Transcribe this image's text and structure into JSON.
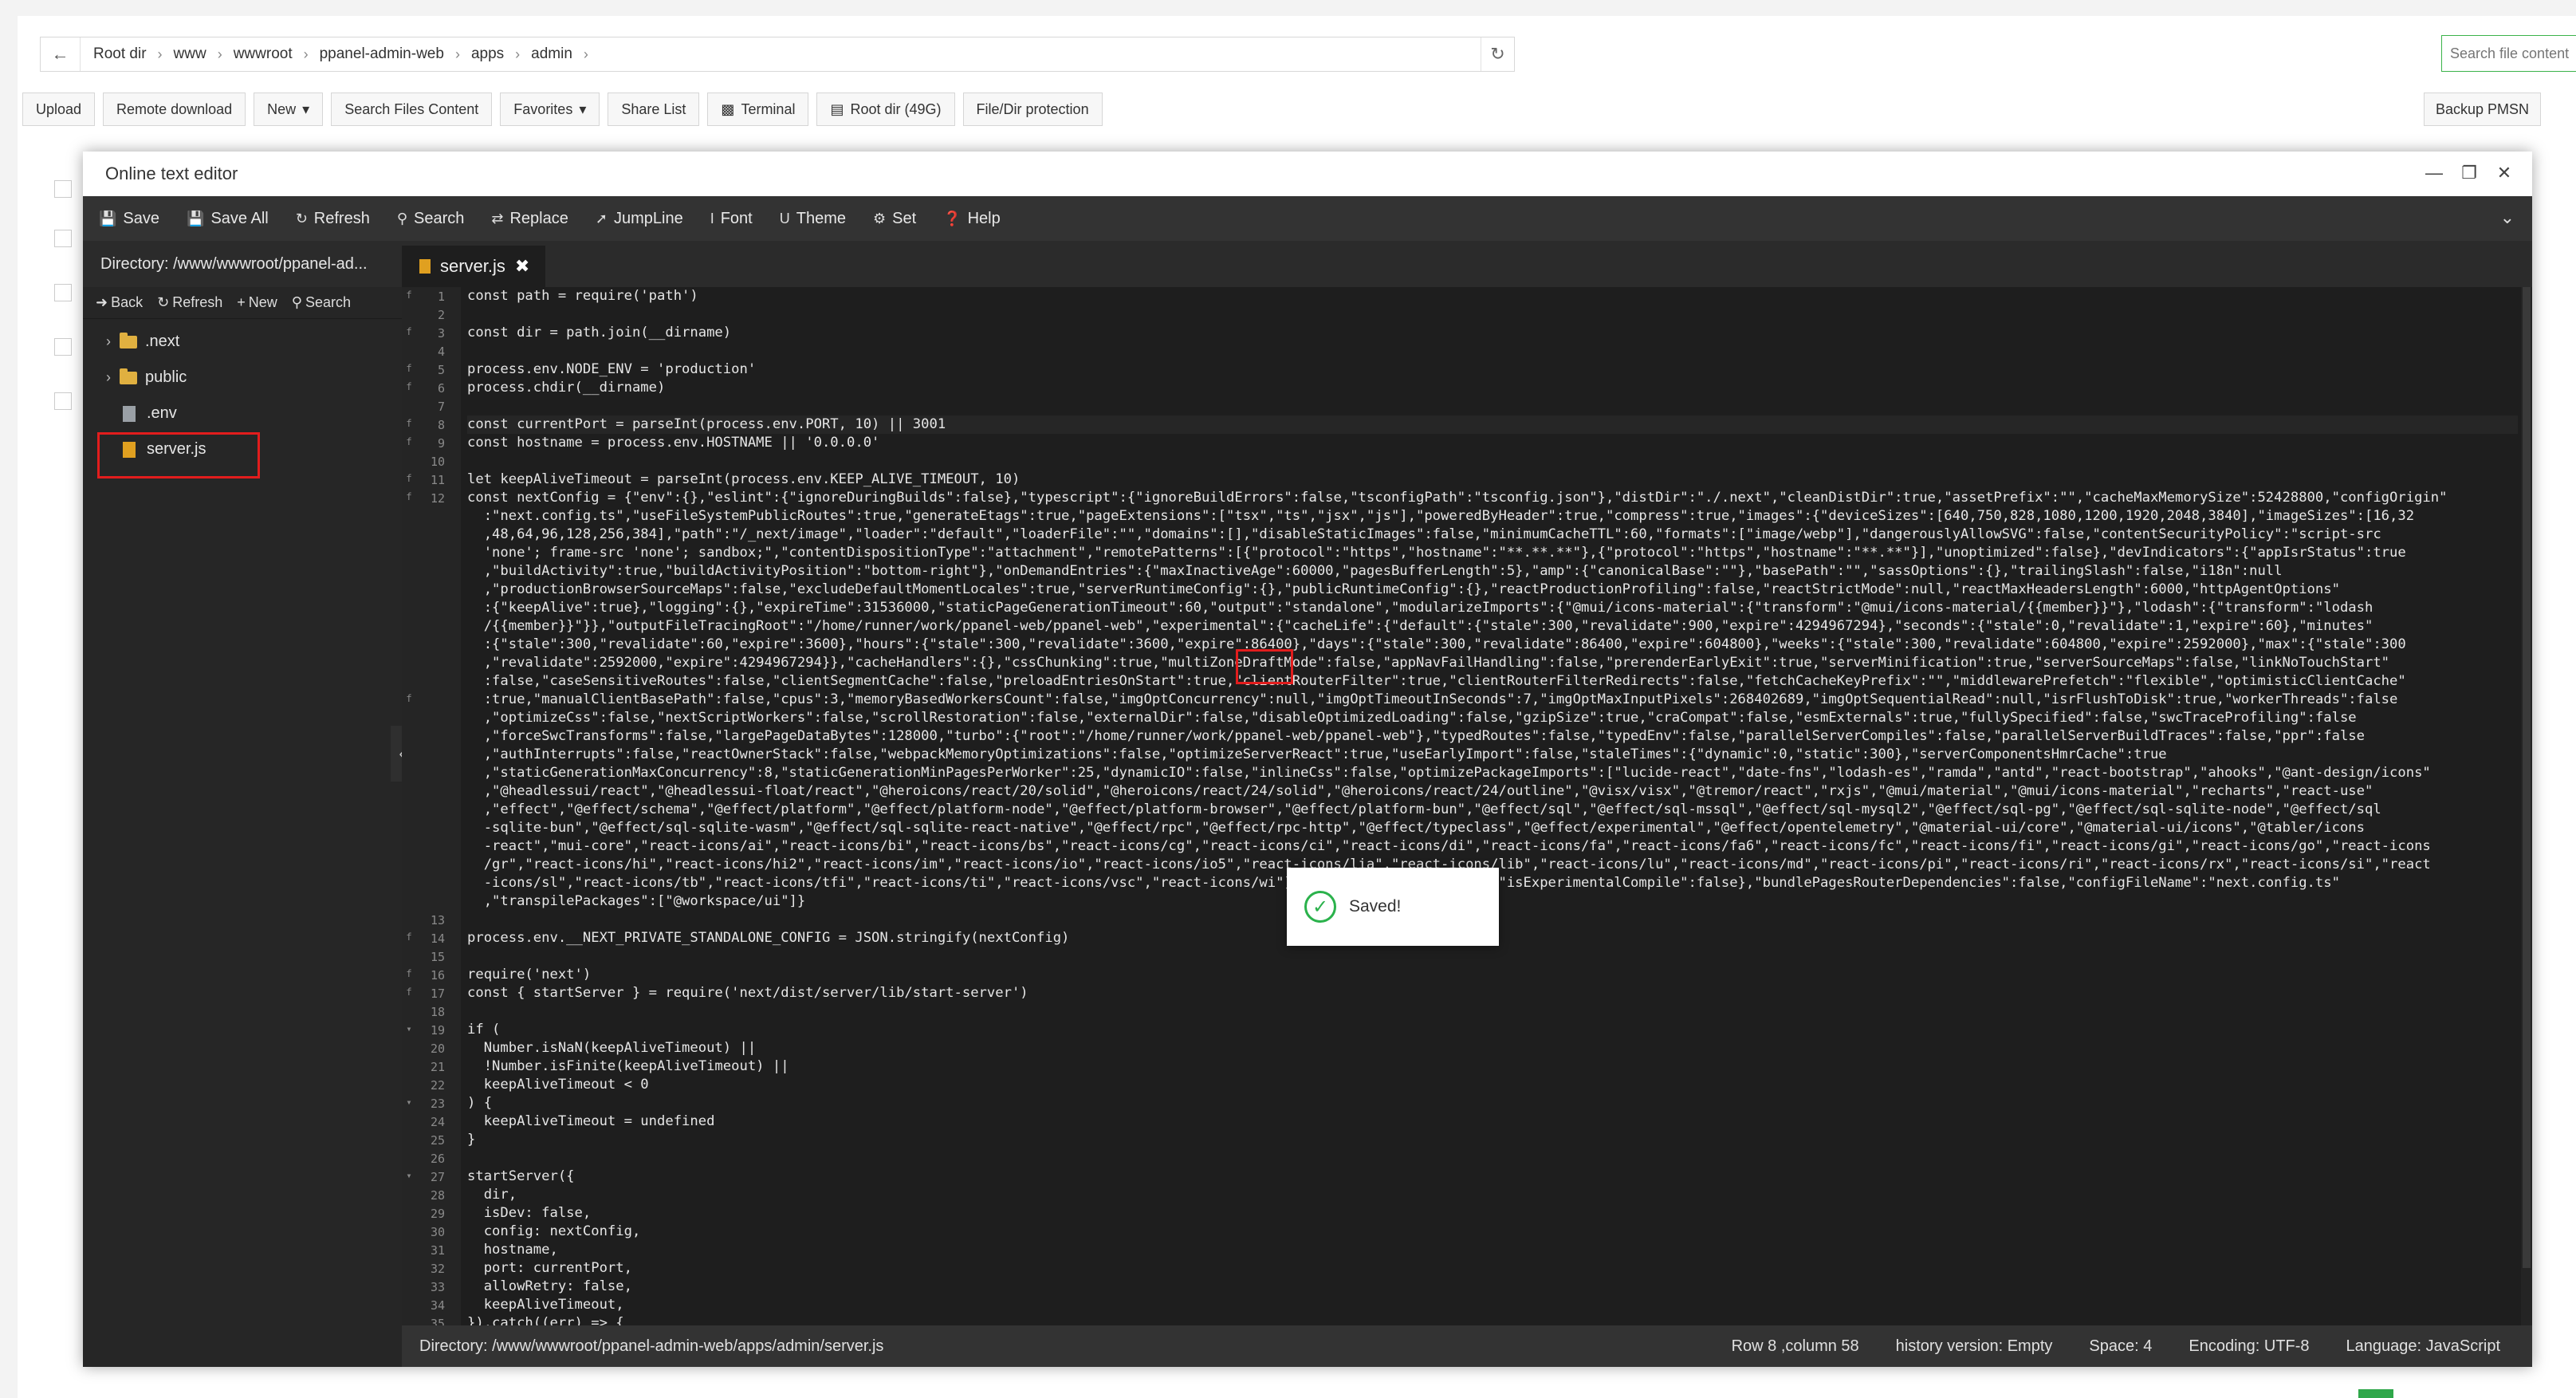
{
  "file_manager": {
    "breadcrumbs": [
      "Root dir",
      "www",
      "wwwroot",
      "ppanel-admin-web",
      "apps",
      "admin"
    ],
    "search_placeholder": "Search file content",
    "toolbar": {
      "upload": "Upload",
      "remote_download": "Remote download",
      "new": "New",
      "search_files_content": "Search Files Content",
      "favorites": "Favorites",
      "share_list": "Share List",
      "terminal": "Terminal",
      "root_dir": "Root dir (49G)",
      "file_dir_protection": "File/Dir protection",
      "backup": "Backup PMSN"
    }
  },
  "editor": {
    "window_title": "Online text editor",
    "toolbar": {
      "save": "Save",
      "save_all": "Save All",
      "refresh": "Refresh",
      "search": "Search",
      "replace": "Replace",
      "jumpline": "JumpLine",
      "font": "Font",
      "theme": "Theme",
      "set": "Set",
      "help": "Help"
    },
    "sidebar": {
      "directory": "Directory: /www/wwwroot/ppanel-ad...",
      "actions": {
        "back": "Back",
        "refresh": "Refresh",
        "new": "New",
        "search": "Search"
      },
      "tree": [
        {
          "name": ".next",
          "type": "folder"
        },
        {
          "name": "public",
          "type": "folder"
        },
        {
          "name": ".env",
          "type": "file"
        },
        {
          "name": "server.js",
          "type": "file"
        }
      ]
    },
    "tab": {
      "name": "server.js"
    },
    "toast": "Saved!",
    "status": {
      "directory": "Directory: /www/wwwroot/ppanel-admin-web/apps/admin/server.js",
      "position": "Row 8 ,column 58",
      "history": "history version: Empty",
      "space": "Space: 4",
      "encoding": "Encoding: UTF-8",
      "language": "Language: JavaScript"
    },
    "code": {
      "l1": "const path = require('path')",
      "l3": "const dir = path.join(__dirname)",
      "l5": "process.env.NODE_ENV = 'production'",
      "l6": "process.chdir(__dirname)",
      "l8": "const currentPort = parseInt(process.env.PORT, 10) || 3001",
      "l9": "const hostname = process.env.HOSTNAME || '0.0.0.0'",
      "l11": "let keepAliveTimeout = parseInt(process.env.KEEP_ALIVE_TIMEOUT, 10)",
      "l12": [
        "const nextConfig = {\"env\":{},\"eslint\":{\"ignoreDuringBuilds\":false},\"typescript\":{\"ignoreBuildErrors\":false,\"tsconfigPath\":\"tsconfig.json\"},\"distDir\":\"./.next\",\"cleanDistDir\":true,\"assetPrefix\":\"\",\"cacheMaxMemorySize\":52428800,\"configOrigin\"",
        "  :\"next.config.ts\",\"useFileSystemPublicRoutes\":true,\"generateEtags\":true,\"pageExtensions\":[\"tsx\",\"ts\",\"jsx\",\"js\"],\"poweredByHeader\":true,\"compress\":true,\"images\":{\"deviceSizes\":[640,750,828,1080,1200,1920,2048,3840],\"imageSizes\":[16,32",
        "  ,48,64,96,128,256,384],\"path\":\"/_next/image\",\"loader\":\"default\",\"loaderFile\":\"\",\"domains\":[],\"disableStaticImages\":false,\"minimumCacheTTL\":60,\"formats\":[\"image/webp\"],\"dangerouslyAllowSVG\":false,\"contentSecurityPolicy\":\"script-src",
        "  'none'; frame-src 'none'; sandbox;\",\"contentDispositionType\":\"attachment\",\"remotePatterns\":[{\"protocol\":\"https\",\"hostname\":\"**.**.**\"},{\"protocol\":\"https\",\"hostname\":\"**.**\"}],\"unoptimized\":false},\"devIndicators\":{\"appIsrStatus\":true",
        "  ,\"buildActivity\":true,\"buildActivityPosition\":\"bottom-right\"},\"onDemandEntries\":{\"maxInactiveAge\":60000,\"pagesBufferLength\":5},\"amp\":{\"canonicalBase\":\"\"},\"basePath\":\"\",\"sassOptions\":{},\"trailingSlash\":false,\"i18n\":null",
        "  ,\"productionBrowserSourceMaps\":false,\"excludeDefaultMomentLocales\":true,\"serverRuntimeConfig\":{},\"publicRuntimeConfig\":{},\"reactProductionProfiling\":false,\"reactStrictMode\":null,\"reactMaxHeadersLength\":6000,\"httpAgentOptions\"",
        "  :{\"keepAlive\":true},\"logging\":{},\"expireTime\":31536000,\"staticPageGenerationTimeout\":60,\"output\":\"standalone\",\"modularizeImports\":{\"@mui/icons-material\":{\"transform\":\"@mui/icons-material/{{member}}\"},\"lodash\":{\"transform\":\"lodash",
        "  /{{member}}\"}},\"outputFileTracingRoot\":\"/home/runner/work/ppanel-web/ppanel-web\",\"experimental\":{\"cacheLife\":{\"default\":{\"stale\":300,\"revalidate\":900,\"expire\":4294967294},\"seconds\":{\"stale\":0,\"revalidate\":1,\"expire\":60},\"minutes\"",
        "  :{\"stale\":300,\"revalidate\":60,\"expire\":3600},\"hours\":{\"stale\":300,\"revalidate\":3600,\"expire\":86400},\"days\":{\"stale\":300,\"revalidate\":86400,\"expire\":604800},\"weeks\":{\"stale\":300,\"revalidate\":604800,\"expire\":2592000},\"max\":{\"stale\":300",
        "  ,\"revalidate\":2592000,\"expire\":4294967294}},\"cacheHandlers\":{},\"cssChunking\":true,\"multiZoneDraftMode\":false,\"appNavFailHandling\":false,\"prerenderEarlyExit\":true,\"serverMinification\":true,\"serverSourceMaps\":false,\"linkNoTouchStart\"",
        "  :false,\"caseSensitiveRoutes\":false,\"clientSegmentCache\":false,\"preloadEntriesOnStart\":true,\"clientRouterFilter\":true,\"clientRouterFilterRedirects\":false,\"fetchCacheKeyPrefix\":\"\",\"middlewarePrefetch\":\"flexible\",\"optimisticClientCache\"",
        "  :true,\"manualClientBasePath\":false,\"cpus\":3,\"memoryBasedWorkersCount\":false,\"imgOptConcurrency\":null,\"imgOptTimeoutInSeconds\":7,\"imgOptMaxInputPixels\":268402689,\"imgOptSequentialRead\":null,\"isrFlushToDisk\":true,\"workerThreads\":false",
        "  ,\"optimizeCss\":false,\"nextScriptWorkers\":false,\"scrollRestoration\":false,\"externalDir\":false,\"disableOptimizedLoading\":false,\"gzipSize\":true,\"craCompat\":false,\"esmExternals\":true,\"fullySpecified\":false,\"swcTraceProfiling\":false",
        "  ,\"forceSwcTransforms\":false,\"largePageDataBytes\":128000,\"turbo\":{\"root\":\"/home/runner/work/ppanel-web/ppanel-web\"},\"typedRoutes\":false,\"typedEnv\":false,\"parallelServerCompiles\":false,\"parallelServerBuildTraces\":false,\"ppr\":false",
        "  ,\"authInterrupts\":false,\"reactOwnerStack\":false,\"webpackMemoryOptimizations\":false,\"optimizeServerReact\":true,\"useEarlyImport\":false,\"staleTimes\":{\"dynamic\":0,\"static\":300},\"serverComponentsHmrCache\":true",
        "  ,\"staticGenerationMaxConcurrency\":8,\"staticGenerationMinPagesPerWorker\":25,\"dynamicIO\":false,\"inlineCss\":false,\"optimizePackageImports\":[\"lucide-react\",\"date-fns\",\"lodash-es\",\"ramda\",\"antd\",\"react-bootstrap\",\"ahooks\",\"@ant-design/icons\"",
        "  ,\"@headlessui/react\",\"@headlessui-float/react\",\"@heroicons/react/20/solid\",\"@heroicons/react/24/solid\",\"@heroicons/react/24/outline\",\"@visx/visx\",\"@tremor/react\",\"rxjs\",\"@mui/material\",\"@mui/icons-material\",\"recharts\",\"react-use\"",
        "  ,\"effect\",\"@effect/schema\",\"@effect/platform\",\"@effect/platform-node\",\"@effect/platform-browser\",\"@effect/platform-bun\",\"@effect/sql\",\"@effect/sql-mssql\",\"@effect/sql-mysql2\",\"@effect/sql-pg\",\"@effect/sql-sqlite-node\",\"@effect/sql",
        "  -sqlite-bun\",\"@effect/sql-sqlite-wasm\",\"@effect/sql-sqlite-react-native\",\"@effect/rpc\",\"@effect/rpc-http\",\"@effect/typeclass\",\"@effect/experimental\",\"@effect/opentelemetry\",\"@material-ui/core\",\"@material-ui/icons\",\"@tabler/icons",
        "  -react\",\"mui-core\",\"react-icons/ai\",\"react-icons/bi\",\"react-icons/bs\",\"react-icons/cg\",\"react-icons/ci\",\"react-icons/di\",\"react-icons/fa\",\"react-icons/fa6\",\"react-icons/fc\",\"react-icons/fi\",\"react-icons/gi\",\"react-icons/go\",\"react-icons",
        "  /gr\",\"react-icons/hi\",\"react-icons/hi2\",\"react-icons/im\",\"react-icons/io\",\"react-icons/io5\",\"react-icons/lia\",\"react-icons/lib\",\"react-icons/lu\",\"react-icons/md\",\"react-icons/pi\",\"react-icons/ri\",\"react-icons/rx\",\"react-icons/si\",\"react",
        "  -icons/sl\",\"react-icons/tb\",\"react-icons/tfi\",\"react-icons/ti\",\"react-icons/vsc\",\"react-icons/wi\"],\"trustHostHeader\":false,\"isExperimentalCompile\":false},\"bundlePagesRouterDependencies\":false,\"configFileName\":\"next.config.ts\"",
        "  ,\"transpilePackages\":[\"@workspace/ui\"]}"
      ],
      "l14": "process.env.__NEXT_PRIVATE_STANDALONE_CONFIG = JSON.stringify(nextConfig)",
      "l16": "require('next')",
      "l17": "const { startServer } = require('next/dist/server/lib/start-server')",
      "l19": "if (",
      "l20": "  Number.isNaN(keepAliveTimeout) ||",
      "l21": "  !Number.isFinite(keepAliveTimeout) ||",
      "l22": "  keepAliveTimeout < 0",
      "l23": ") {",
      "l24": "  keepAliveTimeout = undefined",
      "l25": "}",
      "l27": "startServer({",
      "l28": "  dir,",
      "l29": "  isDev: false,",
      "l30": "  config: nextConfig,",
      "l31": "  hostname,",
      "l32": "  port: currentPort,",
      "l33": "  allowRetry: false,",
      "l34": "  keepAliveTimeout,",
      "l35": "}).catch((err) => {"
    }
  }
}
